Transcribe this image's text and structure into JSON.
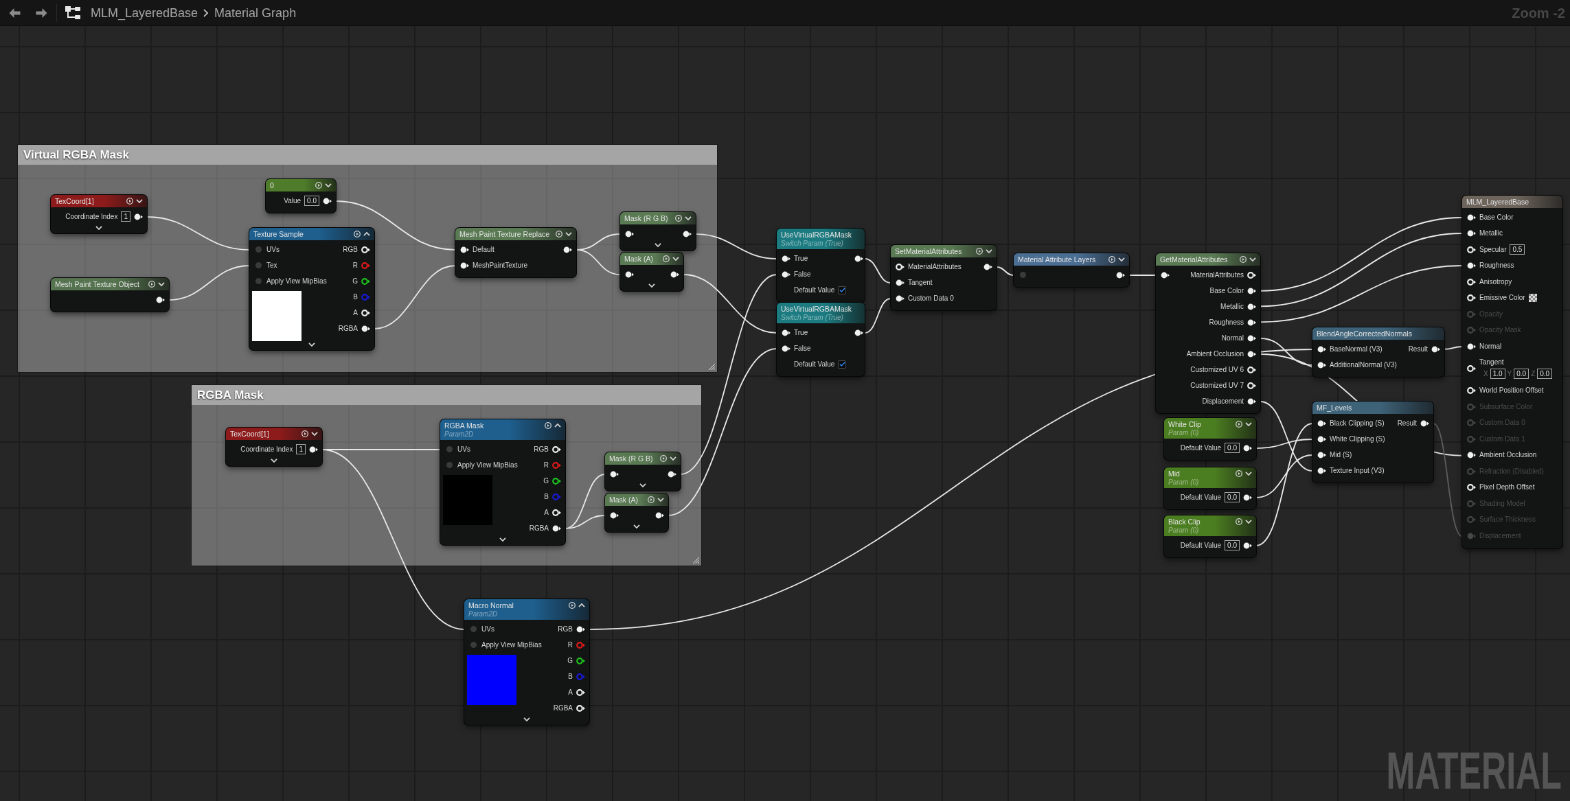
{
  "toolbar": {
    "breadcrumb": [
      "MLM_LayeredBase",
      "Material Graph"
    ],
    "zoom": "Zoom -2"
  },
  "comments": [
    {
      "title": "Virtual RGBA Mask"
    },
    {
      "title": "RGBA Mask"
    }
  ],
  "nodes": [
    {
      "title": "TexCoord[1]",
      "color": "#8e1b1b",
      "expanded": false,
      "advanced": true,
      "outputs": [
        {
          "label": "Coordinate Index",
          "value": "1",
          "kind": "filled"
        }
      ]
    },
    {
      "title": "0",
      "color": "#4e7c2a",
      "expanded": false,
      "outputs": [
        {
          "label": "Value",
          "value": "0.0",
          "kind": "filled"
        }
      ]
    },
    {
      "title": "Mesh Paint Texture Object",
      "color": "#55734f",
      "expanded": false,
      "outputs": [
        {
          "kind": "filled"
        }
      ]
    },
    {
      "title": "Texture Sample",
      "color": "#1e5f8e",
      "expanded": true,
      "advanced": true,
      "inputs": [
        {
          "label": "UVs",
          "kind": "dark"
        },
        {
          "label": "Tex",
          "kind": "dark"
        },
        {
          "label": "Apply View MipBias",
          "kind": "dark"
        }
      ],
      "outputs": [
        {
          "label": "RGB",
          "kind": "ring"
        },
        {
          "label": "R",
          "kind": "ring",
          "color": "#e01a1a"
        },
        {
          "label": "G",
          "kind": "ring",
          "color": "#1cc21c"
        },
        {
          "label": "B",
          "kind": "ring",
          "color": "#1a1ad6"
        },
        {
          "label": "A",
          "kind": "ring"
        },
        {
          "label": "RGBA",
          "kind": "filled"
        }
      ],
      "preview": {
        "color": "#ffffff"
      }
    },
    {
      "title": "Mesh Paint Texture Replace",
      "color": "#5a7a54",
      "expanded": false,
      "inputs": [
        {
          "label": "Default",
          "kind": "filled"
        },
        {
          "label": "MeshPaintTexture",
          "kind": "filled"
        }
      ],
      "outputs": [
        {
          "kind": "filled"
        }
      ]
    },
    {
      "title": "Mask (R G B)",
      "color": "#5a7a54",
      "expanded": false,
      "advanced": true,
      "inputs": [
        {
          "kind": "filled"
        }
      ],
      "outputs": [
        {
          "kind": "filled"
        }
      ]
    },
    {
      "title": "Mask (A)",
      "color": "#5a7a54",
      "expanded": false,
      "advanced": true,
      "inputs": [
        {
          "kind": "filled"
        }
      ],
      "outputs": [
        {
          "kind": "filled"
        }
      ]
    },
    {
      "title": "TexCoord[1]",
      "color": "#8e1b1b",
      "expanded": false,
      "advanced": true,
      "outputs": [
        {
          "label": "Coordinate Index",
          "value": "1",
          "kind": "filled"
        }
      ]
    },
    {
      "title": "RGBA Mask",
      "subtitle": "Param2D",
      "color": "#1e5f8e",
      "expanded": true,
      "advanced": true,
      "inputs": [
        {
          "label": "UVs",
          "kind": "dark"
        },
        {
          "label": "Apply View MipBias",
          "kind": "dark"
        }
      ],
      "outputs": [
        {
          "label": "RGB",
          "kind": "ring"
        },
        {
          "label": "R",
          "kind": "ring",
          "color": "#e01a1a"
        },
        {
          "label": "G",
          "kind": "ring",
          "color": "#1cc21c"
        },
        {
          "label": "B",
          "kind": "ring",
          "color": "#1a1ad6"
        },
        {
          "label": "A",
          "kind": "ring"
        },
        {
          "label": "RGBA",
          "kind": "filled"
        }
      ],
      "preview": {
        "color": "#000000"
      }
    },
    {
      "title": "Mask (R G B)",
      "color": "#5a7a54",
      "expanded": false,
      "advanced": true,
      "inputs": [
        {
          "kind": "filled"
        }
      ],
      "outputs": [
        {
          "kind": "filled"
        }
      ]
    },
    {
      "title": "Mask (A)",
      "color": "#5a7a54",
      "expanded": false,
      "advanced": true,
      "inputs": [
        {
          "kind": "filled"
        }
      ],
      "outputs": [
        {
          "kind": "filled"
        }
      ]
    },
    {
      "title": "Macro Normal",
      "subtitle": "Param2D",
      "color": "#1e5f8e",
      "expanded": true,
      "advanced": true,
      "inputs": [
        {
          "label": "UVs",
          "kind": "dark"
        },
        {
          "label": "Apply View MipBias",
          "kind": "dark"
        }
      ],
      "outputs": [
        {
          "label": "RGB",
          "kind": "filled"
        },
        {
          "label": "R",
          "kind": "ring",
          "color": "#e01a1a"
        },
        {
          "label": "G",
          "kind": "ring",
          "color": "#1cc21c"
        },
        {
          "label": "B",
          "kind": "ring",
          "color": "#1a1ad6"
        },
        {
          "label": "A",
          "kind": "ring"
        },
        {
          "label": "RGBA",
          "kind": "ring"
        }
      ],
      "preview": {
        "color": "#0000ff"
      }
    },
    {
      "title": "UseVirtualRGBAMask",
      "subtitle": "Switch Param (True)",
      "color": "#1b7b80",
      "inputs": [
        {
          "label": "True",
          "kind": "filled"
        },
        {
          "label": "False",
          "kind": "filled"
        },
        {
          "label": "Default Value",
          "kind": "plain",
          "checked": true
        }
      ],
      "outputs": [
        {
          "kind": "filled"
        }
      ]
    },
    {
      "title": "UseVirtualRGBAMask",
      "subtitle": "Switch Param (True)",
      "color": "#1b7b80",
      "inputs": [
        {
          "label": "True",
          "kind": "filled"
        },
        {
          "label": "False",
          "kind": "filled"
        },
        {
          "label": "Default Value",
          "kind": "plain",
          "checked": true
        }
      ],
      "outputs": [
        {
          "kind": "filled"
        }
      ]
    },
    {
      "title": "SetMaterialAttributes",
      "color": "#5a7a54",
      "expanded": false,
      "inputs": [
        {
          "label": "MaterialAttributes",
          "kind": "ring"
        },
        {
          "label": "Tangent",
          "kind": "filled"
        },
        {
          "label": "Custom Data 0",
          "kind": "filled"
        }
      ],
      "outputs": [
        {
          "kind": "filled"
        }
      ]
    },
    {
      "title": "Material Attribute Layers",
      "color": "#4b6e93",
      "expanded": false,
      "inputs": [
        {
          "kind": "dark"
        }
      ],
      "outputs": [
        {
          "kind": "filled"
        }
      ]
    },
    {
      "title": "GetMaterialAttributes",
      "color": "#5a7a54",
      "expanded": false,
      "inputs": [
        {
          "kind": "filled"
        }
      ],
      "outputs": [
        {
          "label": "MaterialAttributes",
          "kind": "ring"
        },
        {
          "label": "Base Color",
          "kind": "filled"
        },
        {
          "label": "Metallic",
          "kind": "filled"
        },
        {
          "label": "Roughness",
          "kind": "filled"
        },
        {
          "label": "Normal",
          "kind": "filled"
        },
        {
          "label": "Ambient Occlusion",
          "kind": "filled"
        },
        {
          "label": "Customized UV 6",
          "kind": "ring"
        },
        {
          "label": "Customized UV 7",
          "kind": "ring"
        },
        {
          "label": "Displacement",
          "kind": "filled"
        }
      ]
    },
    {
      "title": "White Clip",
      "subtitle": "Param (0)",
      "color": "#4b7d21",
      "expanded": false,
      "outputs": [
        {
          "label": "Default Value",
          "value": "0.0",
          "kind": "filled"
        }
      ]
    },
    {
      "title": "Mid",
      "subtitle": "Param (0)",
      "color": "#4b7d21",
      "expanded": false,
      "outputs": [
        {
          "label": "Default Value",
          "value": "0.0",
          "kind": "filled"
        }
      ]
    },
    {
      "title": "Black Clip",
      "subtitle": "Param (0)",
      "color": "#4b7d21",
      "expanded": false,
      "outputs": [
        {
          "label": "Default Value",
          "value": "0.0",
          "kind": "filled"
        }
      ]
    },
    {
      "title": "BlendAngleCorrectedNormals",
      "color": "#3e6379",
      "inputs": [
        {
          "label": "BaseNormal (V3)",
          "kind": "filled"
        },
        {
          "label": "AdditionalNormal (V3)",
          "kind": "filled"
        }
      ],
      "outputs": [
        {
          "label": "Result",
          "kind": "filled"
        }
      ]
    },
    {
      "title": "MF_Levels",
      "color": "#3e6379",
      "inputs": [
        {
          "label": "Black Clipping (S)",
          "kind": "filled"
        },
        {
          "label": "White Clipping (S)",
          "kind": "filled"
        },
        {
          "label": "Mid (S)",
          "kind": "filled"
        },
        {
          "label": "Texture Input (V3)",
          "kind": "filled"
        }
      ],
      "outputs": [
        {
          "label": "Result",
          "kind": "filled"
        }
      ]
    },
    {
      "title": "MLM_LayeredBase",
      "color": "#6d645c",
      "inputs": [
        {
          "label": "Base Color",
          "kind": "filled",
          "disabled": false
        },
        {
          "label": "Metallic",
          "kind": "filled",
          "disabled": false
        },
        {
          "label": "Specular",
          "kind": "ring",
          "value": "0.5",
          "disabled": false
        },
        {
          "label": "Roughness",
          "kind": "filled",
          "disabled": false
        },
        {
          "label": "Anisotropy",
          "kind": "ring",
          "disabled": false
        },
        {
          "label": "Emissive Color",
          "kind": "ring",
          "swatch": true,
          "disabled": false
        },
        {
          "label": "Opacity",
          "kind": "ring",
          "disabled": true
        },
        {
          "label": "Opacity Mask",
          "kind": "ring",
          "disabled": true
        },
        {
          "label": "Normal",
          "kind": "filled",
          "disabled": false
        },
        {
          "label": "Tangent",
          "kind": "ring",
          "vector": [
            {
              "axis": "X",
              "value": "1.0"
            },
            {
              "axis": "Y",
              "value": "0.0"
            },
            {
              "axis": "Z",
              "value": "0.0"
            }
          ],
          "disabled": false
        },
        {
          "label": "World Position Offset",
          "kind": "ring",
          "disabled": false
        },
        {
          "label": "Subsurface Color",
          "kind": "ring",
          "disabled": true
        },
        {
          "label": "Custom Data 0",
          "kind": "ring",
          "disabled": true
        },
        {
          "label": "Custom Data 1",
          "kind": "ring",
          "disabled": true
        },
        {
          "label": "Ambient Occlusion",
          "kind": "filled",
          "disabled": false
        },
        {
          "label": "Refraction (Disabled)",
          "kind": "ring",
          "disabled": true
        },
        {
          "label": "Pixel Depth Offset",
          "kind": "ring",
          "disabled": false
        },
        {
          "label": "Shading Model",
          "kind": "ring",
          "disabled": true
        },
        {
          "label": "Surface Thickness",
          "kind": "ring",
          "disabled": true
        },
        {
          "label": "Displacement",
          "kind": "filled",
          "disabled": true
        }
      ]
    }
  ],
  "graph_label": "MATERIAL"
}
